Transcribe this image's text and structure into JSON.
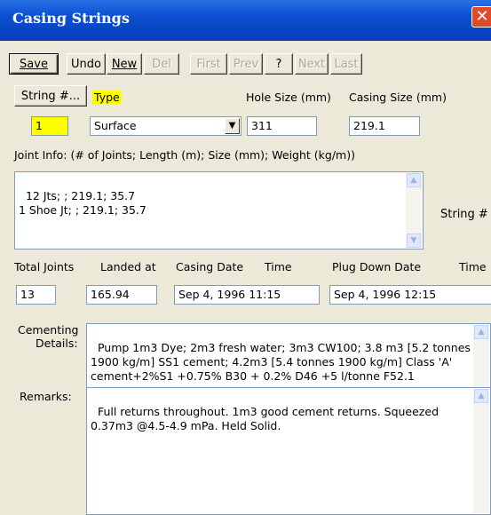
{
  "window": {
    "title": "Casing Strings",
    "close_glyph": "✕"
  },
  "toolbar": {
    "save": "Save",
    "undo": "Undo",
    "new": "New",
    "del": "Del",
    "first": "First",
    "prev": "Prev",
    "help": "?",
    "next": "Next",
    "last": "Last"
  },
  "labels": {
    "string_button": "String #...",
    "type": "Type",
    "hole_size": "Hole Size (mm)",
    "casing_size": "Casing Size (mm)",
    "joint_info": "Joint Info: (# of Joints; Length (m); Size (mm); Weight (kg/m))",
    "string_hash": "String #",
    "total_joints": "Total Joints",
    "landed_at": "Landed at",
    "casing_date": "Casing Date",
    "time": "Time",
    "plug_down_date": "Plug Down Date",
    "plug_time": "Time",
    "cementing": "Cementing",
    "details": "Details:",
    "remarks": "Remarks:"
  },
  "values": {
    "string_number": "1",
    "type": "Surface",
    "hole_size": "311",
    "casing_size": "219.1",
    "joint_info": "12 Jts; ; 219.1; 35.7\n1 Shoe Jt; ; 219.1; 35.7",
    "total_joints": "13",
    "landed_at": "165.94",
    "casing_date": "Sep 4, 1996 11:15",
    "plug_down_date": "Sep 4, 1996 12:15",
    "cementing_details": "Pump 1m3 Dye; 2m3 fresh water; 3m3 CW100; 3.8 m3 [5.2 tonnes 1900 kg/m] SS1 cement; 4.2m3 [5.4 tonnes 1900 kg/m] Class 'A' cement+2%S1 +0.75% B30 + 0.2% D46 +5 l/tonne F52.1",
    "remarks": "Full returns throughout. 1m3 good cement returns. Squeezed 0.37m3 @4.5-4.9 mPa. Held Solid."
  },
  "icons": {
    "scroll_up": "chevron-up-icon",
    "scroll_down": "chevron-down-icon",
    "combo": "chevron-down-icon"
  },
  "colors": {
    "title_bar": "#0a4fd0",
    "highlight": "#ffff00",
    "close": "#e04a2a"
  }
}
